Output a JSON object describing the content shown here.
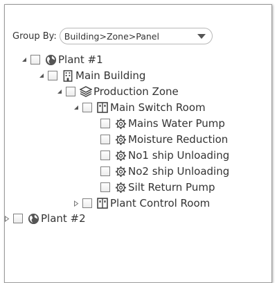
{
  "groupBy": {
    "label": "Group By:",
    "selected": "Building>Zone>Panel"
  },
  "tree": {
    "plant1": "Plant #1",
    "mainBuilding": "Main Building",
    "productionZone": "Production Zone",
    "mainSwitchRoom": "Main Switch Room",
    "devices": [
      "Mains Water Pump",
      "Moisture Reduction",
      "No1 ship Unloading",
      "No2 ship Unloading",
      "Silt Return Pump"
    ],
    "plantControlRoom": "Plant Control Room",
    "plant2": "Plant #2"
  },
  "icons": {
    "expanded": "expanded-triangle-icon",
    "collapsed": "collapsed-triangle-icon",
    "plant": "globe-icon",
    "building": "building-icon",
    "zone": "layers-icon",
    "room": "panel-icon",
    "device": "gear-icon"
  },
  "colors": {
    "icon": "#444444",
    "border": "#9a9a9a"
  }
}
